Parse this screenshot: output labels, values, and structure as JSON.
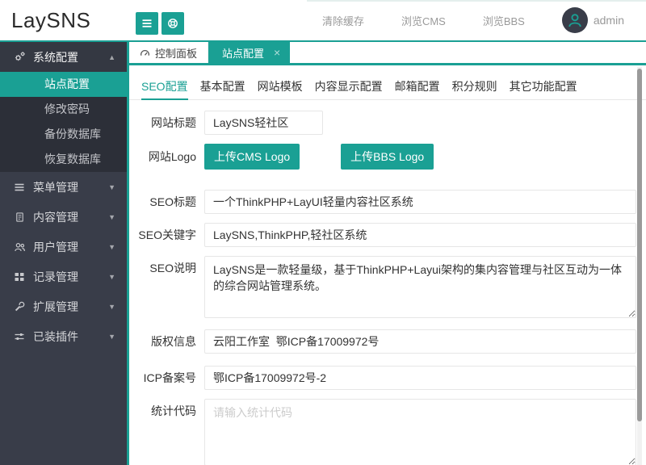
{
  "brand": {
    "logo": "LaySNS"
  },
  "colors": {
    "accent": "#1aa094",
    "sidebar_bg": "#393d49",
    "submenu_bg": "#2c2f38"
  },
  "icons": {
    "caret_up": "▲",
    "caret_down": "▼",
    "close": "×"
  },
  "header": {
    "links": [
      {
        "label": "清除缓存"
      },
      {
        "label": "浏览CMS"
      },
      {
        "label": "浏览BBS"
      }
    ],
    "user": {
      "name": "admin"
    }
  },
  "sidebar": {
    "sections": [
      {
        "label": "系统配置",
        "icon": "cogs-icon",
        "expanded": true,
        "children": [
          {
            "label": "站点配置",
            "active": true
          },
          {
            "label": "修改密码"
          },
          {
            "label": "备份数据库"
          },
          {
            "label": "恢复数据库"
          }
        ]
      },
      {
        "label": "菜单管理",
        "icon": "menu-icon"
      },
      {
        "label": "内容管理",
        "icon": "document-icon"
      },
      {
        "label": "用户管理",
        "icon": "users-icon"
      },
      {
        "label": "记录管理",
        "icon": "grid-icon"
      },
      {
        "label": "扩展管理",
        "icon": "wrench-icon"
      },
      {
        "label": "已装插件",
        "icon": "sliders-icon"
      }
    ]
  },
  "tabbar": {
    "tabs": [
      {
        "label": "控制面板",
        "icon": "dashboard-icon"
      },
      {
        "label": "站点配置",
        "active": true,
        "closable": true
      }
    ]
  },
  "subtabs": {
    "active": "SEO配置",
    "items": [
      "SEO配置",
      "基本配置",
      "网站模板",
      "内容显示配置",
      "邮箱配置",
      "积分规则",
      "其它功能配置"
    ]
  },
  "form": {
    "fields": [
      {
        "label": "网站标题",
        "type": "input",
        "value": "LaySNS轻社区"
      },
      {
        "label": "网站Logo",
        "type": "buttons",
        "buttons": [
          "上传CMS Logo",
          "上传BBS Logo"
        ]
      },
      {
        "label": "SEO标题",
        "type": "input",
        "value": "一个ThinkPHP+LayUI轻量内容社区系统"
      },
      {
        "label": "SEO关键字",
        "type": "input",
        "value": "LaySNS,ThinkPHP,轻社区系统"
      },
      {
        "label": "SEO说明",
        "type": "textarea",
        "value": "LaySNS是一款轻量级，基于ThinkPHP+Layui架构的集内容管理与社区互动为一体的综合网站管理系统。"
      },
      {
        "label": "版权信息",
        "type": "input",
        "value": "云阳工作室  鄂ICP备17009972号"
      },
      {
        "label": "ICP备案号",
        "type": "input",
        "value": "鄂ICP备17009972号-2"
      },
      {
        "label": "统计代码",
        "type": "textarea",
        "value": "",
        "placeholder": "请输入统计代码"
      }
    ]
  }
}
